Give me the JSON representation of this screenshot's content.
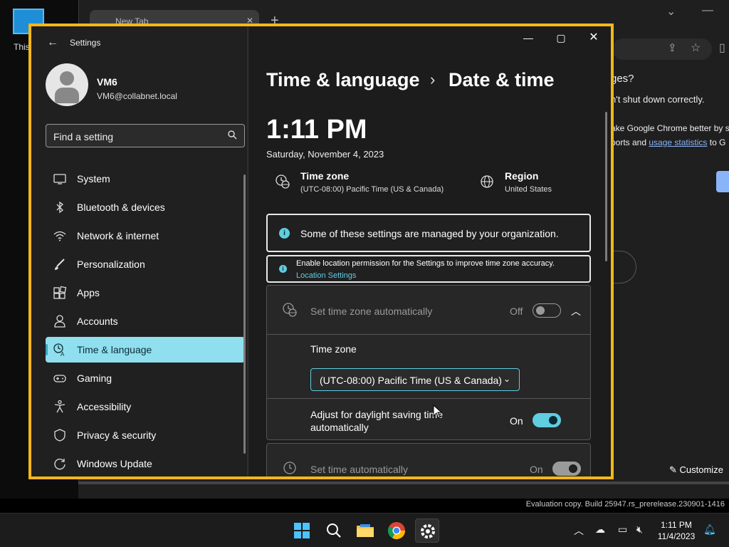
{
  "desktop": {
    "icon_label": "This"
  },
  "chrome": {
    "tab_label": "New Tab",
    "text_line1": "ges?",
    "text_line2": "n't shut down correctly.",
    "text_line3": "ake Google Chrome better by s",
    "text_line4a": "ports and ",
    "text_line4_link": "usage statistics",
    "text_line4b": " to G",
    "customize_label": "Customize"
  },
  "settings": {
    "app_title": "Settings",
    "user": {
      "name": "VM6",
      "email": "VM6@collabnet.local"
    },
    "search_placeholder": "Find a setting",
    "nav": [
      {
        "label": "System",
        "icon": "monitor-icon"
      },
      {
        "label": "Bluetooth & devices",
        "icon": "bluetooth-icon"
      },
      {
        "label": "Network & internet",
        "icon": "wifi-icon"
      },
      {
        "label": "Personalization",
        "icon": "brush-icon"
      },
      {
        "label": "Apps",
        "icon": "apps-icon"
      },
      {
        "label": "Accounts",
        "icon": "person-icon"
      },
      {
        "label": "Time & language",
        "icon": "time-language-icon",
        "active": true
      },
      {
        "label": "Gaming",
        "icon": "gamepad-icon"
      },
      {
        "label": "Accessibility",
        "icon": "accessibility-icon"
      },
      {
        "label": "Privacy & security",
        "icon": "shield-icon"
      },
      {
        "label": "Windows Update",
        "icon": "update-icon"
      }
    ],
    "breadcrumb_parent": "Time & language",
    "breadcrumb_sep": "›",
    "page_title": "Date & time",
    "clock": "1:11 PM",
    "date": "Saturday, November 4, 2023",
    "time_zone_label": "Time zone",
    "time_zone_value": "(UTC-08:00) Pacific Time (US & Canada)",
    "region_label": "Region",
    "region_value": "United States",
    "managed_notice": "Some of these settings are managed by your organization.",
    "location_notice": "Enable location permission for the Settings to improve time zone accuracy.",
    "location_link": "Location Settings",
    "set_tz_auto_label": "Set time zone automatically",
    "set_tz_auto_state": "Off",
    "tz_section_label": "Time zone",
    "tz_dropdown_value": "(UTC-08:00) Pacific Time (US & Canada)",
    "dst_label_line1": "Adjust for daylight saving time",
    "dst_label_line2": "automatically",
    "dst_state": "On",
    "set_time_auto_label": "Set time automatically",
    "set_time_auto_state": "On"
  },
  "statusbar": {
    "eval_text": "Evaluation copy. Build 25947.rs_prerelease.230901-1416"
  },
  "taskbar": {
    "time": "1:11 PM",
    "date": "11/4/2023"
  },
  "colors": {
    "accent": "#60cde0",
    "window_border": "#f3b719"
  }
}
